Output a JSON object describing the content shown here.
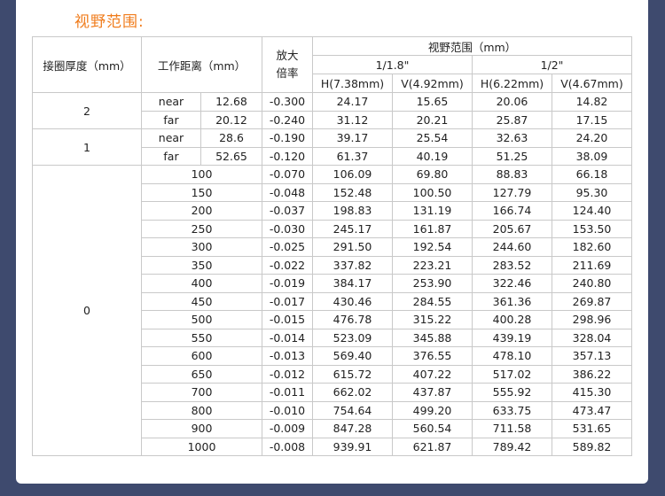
{
  "section_title": "视野范围:",
  "table": {
    "headers": {
      "ring_thickness": "接圈厚度（mm）",
      "working_distance": "工作距离（mm）",
      "magnification": "放大倍率",
      "fov": "视野范围（mm）",
      "sensor_a": "1/1.8\"",
      "sensor_b": "1/2\"",
      "h_a": "H(7.38mm)",
      "v_a": "V(4.92mm)",
      "h_b": "H(6.22mm)",
      "v_b": "V(4.67mm)"
    },
    "groups": [
      {
        "ring": "2",
        "rows": [
          {
            "label": "near",
            "distance": "12.68",
            "mag": "-0.300",
            "h_a": "24.17",
            "v_a": "15.65",
            "h_b": "20.06",
            "v_b": "14.82"
          },
          {
            "label": "far",
            "distance": "20.12",
            "mag": "-0.240",
            "h_a": "31.12",
            "v_a": "20.21",
            "h_b": "25.87",
            "v_b": "17.15"
          }
        ]
      },
      {
        "ring": "1",
        "rows": [
          {
            "label": "near",
            "distance": "28.6",
            "mag": "-0.190",
            "h_a": "39.17",
            "v_a": "25.54",
            "h_b": "32.63",
            "v_b": "24.20"
          },
          {
            "label": "far",
            "distance": "52.65",
            "mag": "-0.120",
            "h_a": "61.37",
            "v_a": "40.19",
            "h_b": "51.25",
            "v_b": "38.09"
          }
        ]
      },
      {
        "ring": "0",
        "rows": [
          {
            "distance": "100",
            "mag": "-0.070",
            "h_a": "106.09",
            "v_a": "69.80",
            "h_b": "88.83",
            "v_b": "66.18"
          },
          {
            "distance": "150",
            "mag": "-0.048",
            "h_a": "152.48",
            "v_a": "100.50",
            "h_b": "127.79",
            "v_b": "95.30"
          },
          {
            "distance": "200",
            "mag": "-0.037",
            "h_a": "198.83",
            "v_a": "131.19",
            "h_b": "166.74",
            "v_b": "124.40"
          },
          {
            "distance": "250",
            "mag": "-0.030",
            "h_a": "245.17",
            "v_a": "161.87",
            "h_b": "205.67",
            "v_b": "153.50"
          },
          {
            "distance": "300",
            "mag": "-0.025",
            "h_a": "291.50",
            "v_a": "192.54",
            "h_b": "244.60",
            "v_b": "182.60"
          },
          {
            "distance": "350",
            "mag": "-0.022",
            "h_a": "337.82",
            "v_a": "223.21",
            "h_b": "283.52",
            "v_b": "211.69"
          },
          {
            "distance": "400",
            "mag": "-0.019",
            "h_a": "384.17",
            "v_a": "253.90",
            "h_b": "322.46",
            "v_b": "240.80"
          },
          {
            "distance": "450",
            "mag": "-0.017",
            "h_a": "430.46",
            "v_a": "284.55",
            "h_b": "361.36",
            "v_b": "269.87"
          },
          {
            "distance": "500",
            "mag": "-0.015",
            "h_a": "476.78",
            "v_a": "315.22",
            "h_b": "400.28",
            "v_b": "298.96"
          },
          {
            "distance": "550",
            "mag": "-0.014",
            "h_a": "523.09",
            "v_a": "345.88",
            "h_b": "439.19",
            "v_b": "328.04"
          },
          {
            "distance": "600",
            "mag": "-0.013",
            "h_a": "569.40",
            "v_a": "376.55",
            "h_b": "478.10",
            "v_b": "357.13"
          },
          {
            "distance": "650",
            "mag": "-0.012",
            "h_a": "615.72",
            "v_a": "407.22",
            "h_b": "517.02",
            "v_b": "386.22"
          },
          {
            "distance": "700",
            "mag": "-0.011",
            "h_a": "662.02",
            "v_a": "437.87",
            "h_b": "555.92",
            "v_b": "415.30"
          },
          {
            "distance": "800",
            "mag": "-0.010",
            "h_a": "754.64",
            "v_a": "499.20",
            "h_b": "633.75",
            "v_b": "473.47"
          },
          {
            "distance": "900",
            "mag": "-0.009",
            "h_a": "847.28",
            "v_a": "560.54",
            "h_b": "711.58",
            "v_b": "531.65"
          },
          {
            "distance": "1000",
            "mag": "-0.008",
            "h_a": "939.91",
            "v_a": "621.87",
            "h_b": "789.42",
            "v_b": "589.82"
          }
        ]
      }
    ]
  },
  "colors": {
    "background": "#3e4a6e",
    "title": "#f07c1c",
    "grid": "#c9c9c9"
  }
}
